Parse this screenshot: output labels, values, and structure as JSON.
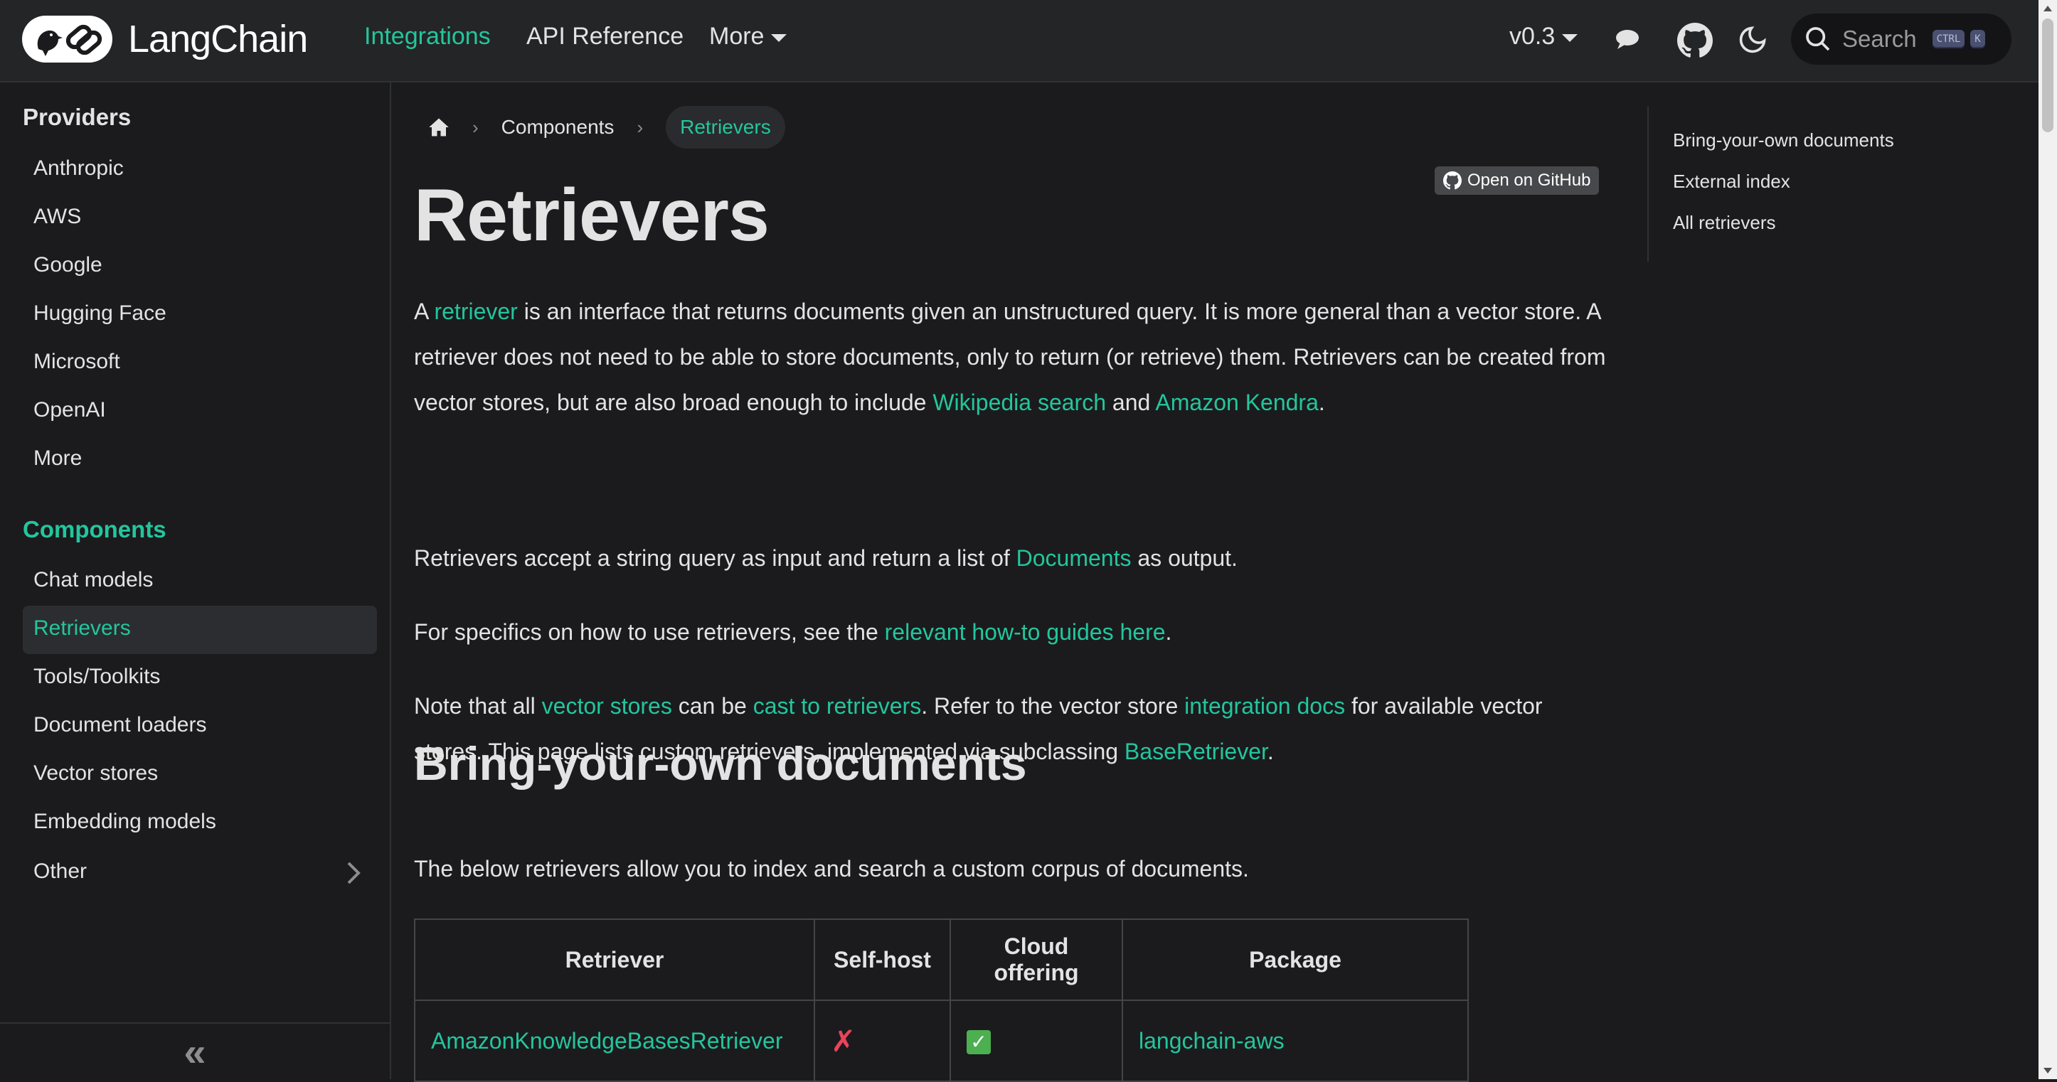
{
  "nav": {
    "brand": "LangChain",
    "links": [
      "Integrations",
      "API Reference",
      "More"
    ],
    "version": "v0.3",
    "search_label": "Search",
    "kbd_ctrl": "CTRL",
    "kbd_k": "K"
  },
  "sidebar": {
    "providers_title": "Providers",
    "providers": [
      "Anthropic",
      "AWS",
      "Google",
      "Hugging Face",
      "Microsoft",
      "OpenAI",
      "More"
    ],
    "components_title": "Components",
    "components": [
      "Chat models",
      "Retrievers",
      "Tools/Toolkits",
      "Document loaders",
      "Vector stores",
      "Embedding models",
      "Other"
    ],
    "collapse_glyph": "«"
  },
  "breadcrumb": {
    "item1": "Components",
    "current": "Retrievers"
  },
  "github_button": "Open on GitHub",
  "page": {
    "title": "Retrievers",
    "p1": {
      "t1": "A ",
      "l1": "retriever",
      "t2": " is an interface that returns documents given an unstructured query. It is more general than a vector store. A retriever does not need to be able to store documents, only to return (or retrieve) them. Retrievers can be created from vector stores, but are also broad enough to include ",
      "l2": "Wikipedia search",
      "t3": " and ",
      "l3": "Amazon Kendra",
      "t4": "."
    },
    "p2": {
      "t1": "Retrievers accept a string query as input and return a list of ",
      "l1": "Documents",
      "t2": " as output."
    },
    "p3": {
      "t1": "For specifics on how to use retrievers, see the ",
      "l1": "relevant how-to guides here",
      "t2": "."
    },
    "p4": {
      "t1": "Note that all ",
      "l1": "vector stores",
      "t2": " can be ",
      "l2": "cast to retrievers",
      "t3": ". Refer to the vector store ",
      "l3": "integration docs",
      "t4": " for available vector stores. This page lists custom retrievers, implemented via subclassing ",
      "l4": "BaseRetriever",
      "t5": "."
    },
    "section_title": "Bring-your-own documents",
    "p5": "The below retrievers allow you to index and search a custom corpus of documents.",
    "table": {
      "headers": [
        "Retriever",
        "Self-host",
        "Cloud offering",
        "Package"
      ],
      "rows": [
        {
          "retriever": "AmazonKnowledgeBasesRetriever",
          "self_host": "✗",
          "cloud": "✓",
          "package": "langchain-aws"
        }
      ]
    }
  },
  "toc": [
    "Bring-your-own documents",
    "External index",
    "All retrievers"
  ],
  "colors": {
    "accent": "#23c69e",
    "background": "#1b1b1d",
    "navbar": "#242526",
    "cross": "#e8445a",
    "check": "#4caf50"
  }
}
